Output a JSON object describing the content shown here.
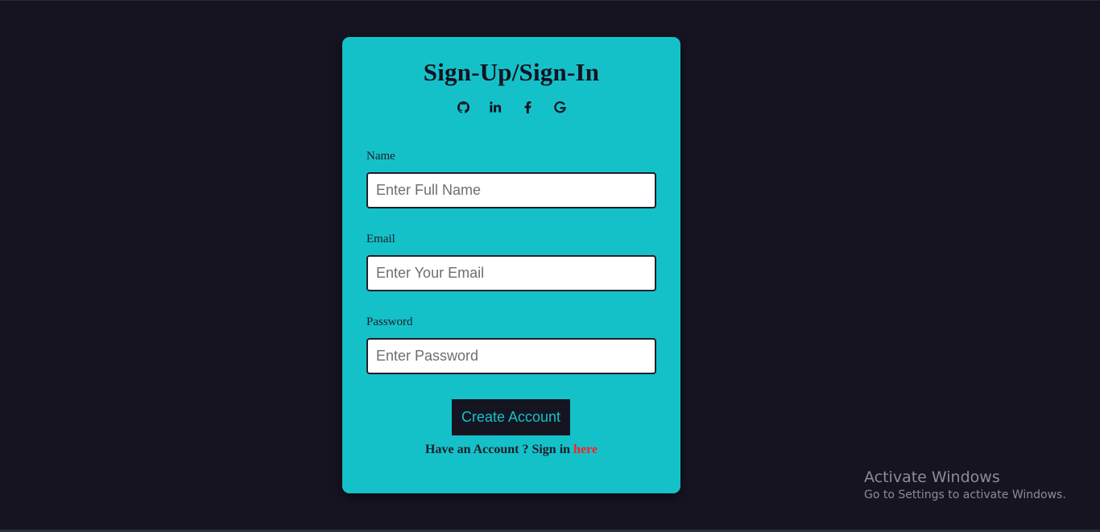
{
  "form": {
    "title": "Sign-Up/Sign-In",
    "social_icons": [
      "github-icon",
      "linkedin-icon",
      "facebook-icon",
      "google-icon"
    ],
    "fields": [
      {
        "label": "Name",
        "placeholder": "Enter Full Name",
        "value": ""
      },
      {
        "label": "Email",
        "placeholder": "Enter Your Email",
        "value": ""
      },
      {
        "label": "Password",
        "placeholder": "Enter Password",
        "value": ""
      }
    ],
    "submit_label": "Create Account",
    "signin_prompt": "Have an Account ? Sign in",
    "signin_link": "here"
  },
  "watermark": {
    "title": "Activate Windows",
    "subtitle": "Go to Settings to activate Windows."
  },
  "colors": {
    "background": "#161421",
    "card": "#15c1c9",
    "button": "#151421",
    "button_text": "#15c1c9",
    "link": "#ff1f1f"
  }
}
